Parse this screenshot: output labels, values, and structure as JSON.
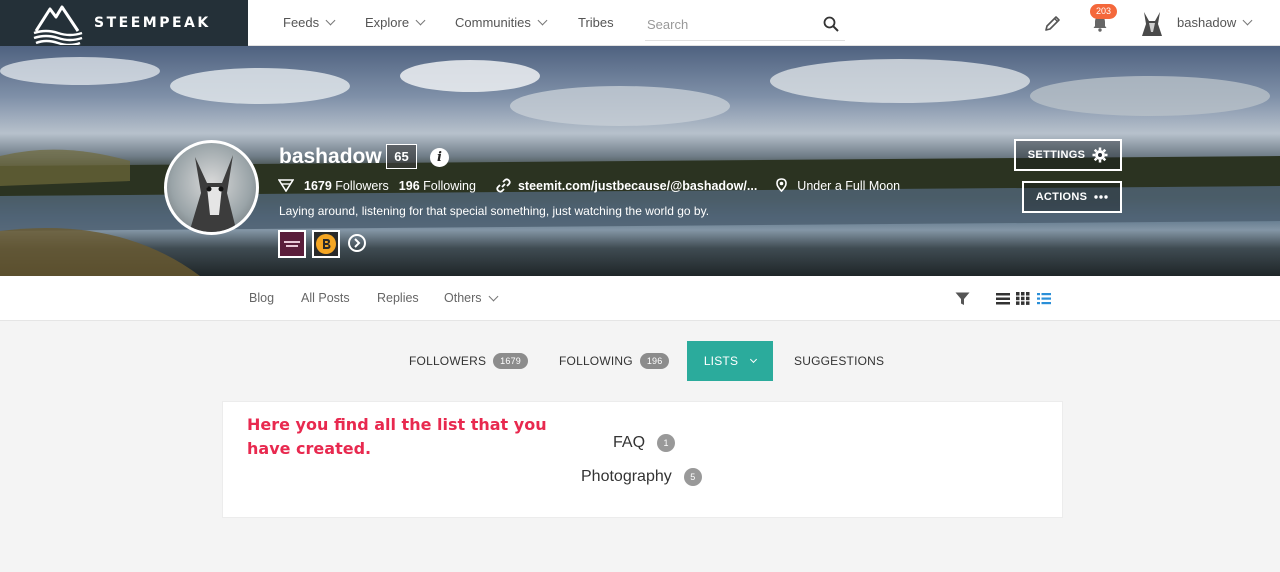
{
  "brand": {
    "name": "STEEMPEAK"
  },
  "nav": {
    "items": [
      {
        "label": "Feeds",
        "dropdown": true
      },
      {
        "label": "Explore",
        "dropdown": true
      },
      {
        "label": "Communities",
        "dropdown": true
      },
      {
        "label": "Tribes",
        "dropdown": false
      }
    ],
    "search_placeholder": "Search",
    "notification_count": "203",
    "username": "bashadow"
  },
  "profile": {
    "name": "bashadow",
    "reputation": "65",
    "followers_count": "1679",
    "followers_label": "Followers",
    "following_count": "196",
    "following_label": "Following",
    "link": "steemit.com/justbecause/@bashadow/...",
    "location": "Under a Full Moon",
    "bio": "Laying around, listening for that special something, just watching the world go by.",
    "settings_label": "SETTINGS",
    "actions_label": "ACTIONS"
  },
  "subnav": {
    "items": [
      "Blog",
      "All Posts",
      "Replies",
      "Others"
    ]
  },
  "tabs": {
    "followers_label": "FOLLOWERS",
    "followers_count": "1679",
    "following_label": "FOLLOWING",
    "following_count": "196",
    "lists_label": "LISTS",
    "suggestions_label": "SUGGESTIONS"
  },
  "lists": {
    "annotation": "Here you find all the list that you have created.",
    "items": [
      {
        "name": "FAQ",
        "count": "1"
      },
      {
        "name": "Photography",
        "count": "5"
      }
    ]
  },
  "colors": {
    "brand_bg": "#243038",
    "accent": "#2bab9c",
    "notification": "#f4683b",
    "annotation": "#e8294f"
  }
}
